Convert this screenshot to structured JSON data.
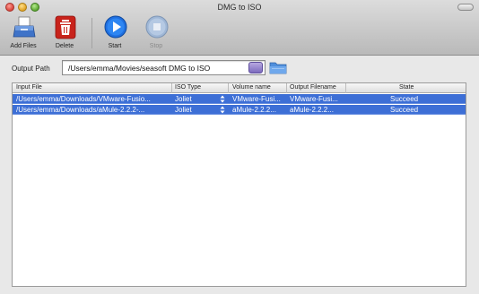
{
  "window": {
    "title": "DMG to ISO"
  },
  "toolbar": {
    "add_files": "Add Files",
    "delete": "Delete",
    "start": "Start",
    "stop": "Stop"
  },
  "output": {
    "label": "Output Path",
    "value": "/Users/emma/Movies/seasoft DMG to ISO"
  },
  "table": {
    "headers": [
      "Input File",
      "ISO Type",
      "Volume name",
      "Output Filename",
      "State"
    ],
    "rows": [
      [
        "/Users/emma/Downloads/VMware-Fusio...",
        "Joliet",
        "VMware-Fusi...",
        "VMware-Fusi...",
        "Succeed"
      ],
      [
        "/Users/emma/Downloads/aMule-2.2.2-...",
        "Joliet",
        "aMule-2.2.2...",
        "aMule-2.2.2...",
        "Succeed"
      ]
    ]
  },
  "colors": {
    "selection": "#3d6fd6",
    "delete_red": "#c8231b",
    "start_blue": "#1f6fe0"
  },
  "icons": {
    "add_files": "add-files-icon",
    "delete": "trash-icon",
    "start": "play-icon",
    "stop": "stop-icon",
    "browse": "folder-icon",
    "reveal": "reveal-icon"
  }
}
